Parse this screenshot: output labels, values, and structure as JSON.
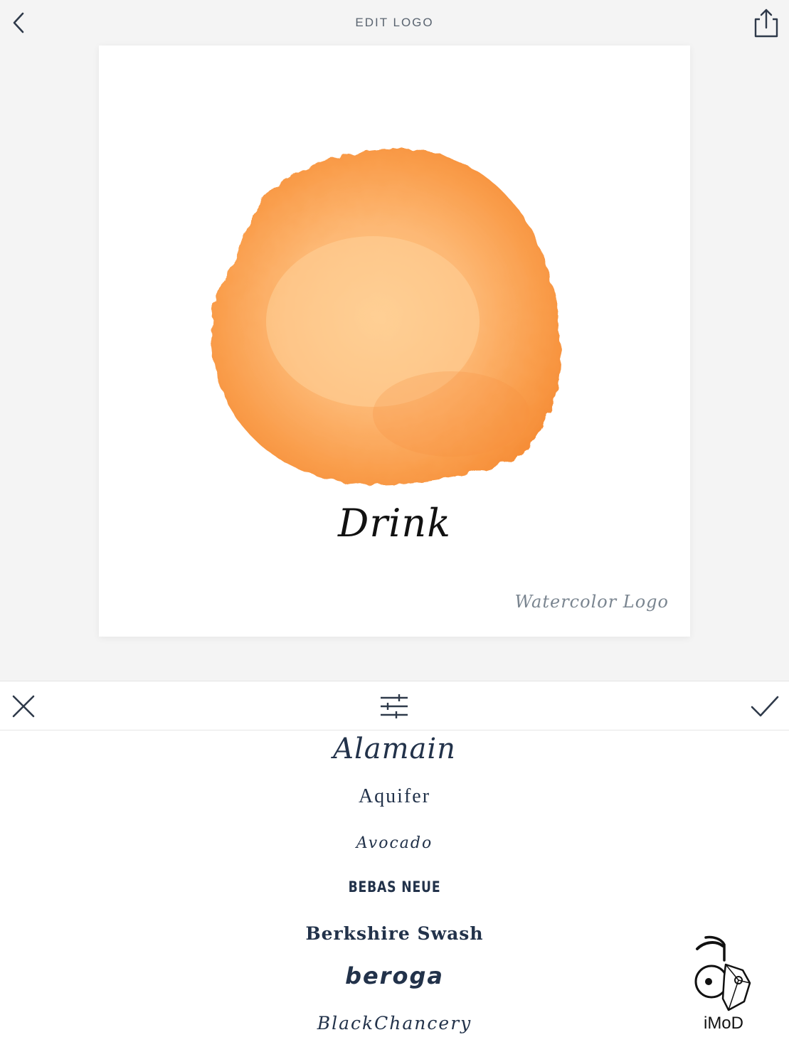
{
  "header": {
    "title": "EDIT LOGO",
    "back_icon": "chevron-left-icon",
    "share_icon": "share-icon"
  },
  "logo_canvas": {
    "logo_text": "Drink",
    "watermark": "Watercolor Logo",
    "blob_color": "#f7a04a"
  },
  "toolbar": {
    "close_icon": "close-icon",
    "adjust_icon": "sliders-icon",
    "confirm_icon": "checkmark-icon"
  },
  "font_list": {
    "items": [
      "Alamain",
      "Aquifer",
      "Avocado",
      "BEBAS NEUE",
      "Berkshire Swash",
      "beroga",
      "BlackChancery"
    ]
  },
  "overlay": {
    "brand": "iMoD"
  },
  "colors": {
    "background": "#f4f4f4",
    "text_dark": "#22324a",
    "title_gray": "#5a6470"
  }
}
